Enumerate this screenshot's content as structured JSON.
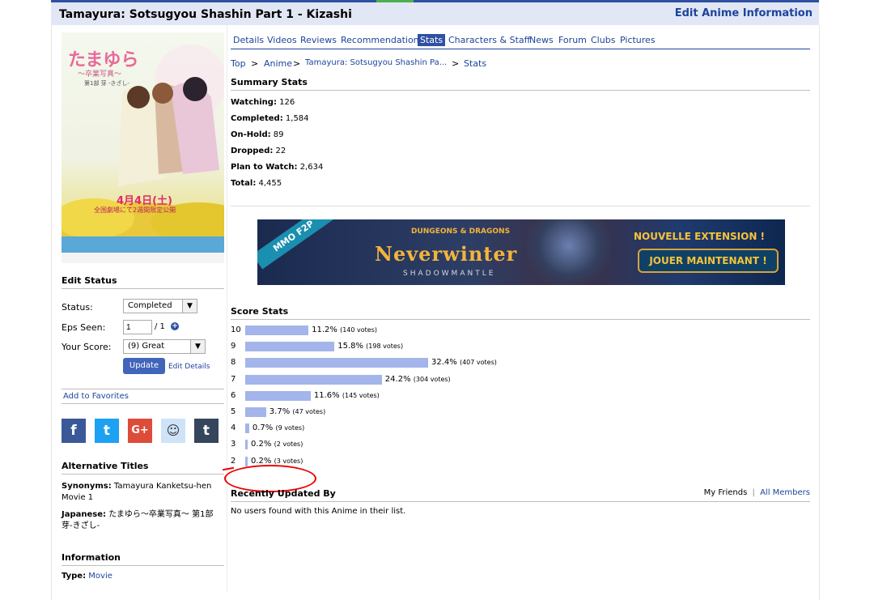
{
  "header": {
    "title": "Tamayura: Sotsugyou Shashin Part 1 - Kizashi",
    "edit_link": "Edit Anime Information"
  },
  "poster": {
    "jp_title": "たまゆら",
    "jp_sub": "〜卒業写真〜",
    "jp_part": "第1部 芽 -きざし-",
    "date": "4月4日(土)",
    "release": "全国劇場にて2週間限定公開"
  },
  "edit_status": {
    "heading": "Edit Status",
    "status_label": "Status:",
    "status_value": "Completed",
    "eps_label": "Eps Seen:",
    "eps_value": "1",
    "eps_total": "/ 1",
    "score_label": "Your Score:",
    "score_value": "(9) Great",
    "update_label": "Update",
    "edit_details_label": "Edit Details"
  },
  "favorites_label": "Add to Favorites",
  "social": [
    {
      "label": "f",
      "icon": "facebook-icon",
      "color": "#3b5998"
    },
    {
      "label": "t",
      "icon": "twitter-icon",
      "color": "#1da1f2"
    },
    {
      "label": "G+",
      "icon": "google-plus-icon",
      "color": "#dd4b39"
    },
    {
      "label": "☺",
      "icon": "reddit-icon",
      "color": "#cee3f8"
    },
    {
      "label": "t",
      "icon": "tumblr-icon",
      "color": "#35465c"
    }
  ],
  "alt_titles": {
    "heading": "Alternative Titles",
    "synonyms_label": "Synonyms:",
    "synonyms_value": "Tamayura Kanketsu-hen Movie 1",
    "japanese_label": "Japanese:",
    "japanese_value": "たまゆら〜卒業写真〜 第1部 芽-きざし-"
  },
  "information": {
    "heading": "Information",
    "type_label": "Type:",
    "type_value": "Movie"
  },
  "tabs": [
    "Details",
    "Videos",
    "Reviews",
    "Recommendations",
    "Stats",
    "Characters & Staff",
    "News",
    "Forum",
    "Clubs",
    "Pictures"
  ],
  "active_tab": "Stats",
  "breadcrumb": [
    "Top",
    "Anime",
    "Tamayura: Sotsugyou Shashin Pa...",
    "Stats"
  ],
  "summary": {
    "heading": "Summary Stats",
    "items": [
      {
        "label": "Watching:",
        "value": "126"
      },
      {
        "label": "Completed:",
        "value": "1,584"
      },
      {
        "label": "On-Hold:",
        "value": "89"
      },
      {
        "label": "Dropped:",
        "value": "22"
      },
      {
        "label": "Plan to Watch:",
        "value": "2,634"
      },
      {
        "label": "Total:",
        "value": "4,455"
      }
    ]
  },
  "ad": {
    "badge": "MMO F2P",
    "brand": "DUNGEONS & DRAGONS",
    "logo": "Neverwinter",
    "sub": "SHADOWMANTLE",
    "headline": "NOUVELLE EXTENSION !",
    "cta": "JOUER MAINTENANT !"
  },
  "score_stats": {
    "heading": "Score Stats",
    "rows": [
      {
        "score": "10",
        "pct": "11.2%",
        "votes": "(140 votes)",
        "fraction": 0.112
      },
      {
        "score": "9",
        "pct": "15.8%",
        "votes": "(198 votes)",
        "fraction": 0.158
      },
      {
        "score": "8",
        "pct": "32.4%",
        "votes": "(407 votes)",
        "fraction": 0.324
      },
      {
        "score": "7",
        "pct": "24.2%",
        "votes": "(304 votes)",
        "fraction": 0.242
      },
      {
        "score": "6",
        "pct": "11.6%",
        "votes": "(145 votes)",
        "fraction": 0.116
      },
      {
        "score": "5",
        "pct": "3.7%",
        "votes": "(47 votes)",
        "fraction": 0.037
      },
      {
        "score": "4",
        "pct": "0.7%",
        "votes": "(9 votes)",
        "fraction": 0.007
      },
      {
        "score": "3",
        "pct": "0.2%",
        "votes": "(2 votes)",
        "fraction": 0.002
      },
      {
        "score": "2",
        "pct": "0.2%",
        "votes": "(3 votes)",
        "fraction": 0.002
      }
    ]
  },
  "recent": {
    "heading": "Recently Updated By",
    "friends": "My Friends",
    "divider": "|",
    "all_members": "All Members",
    "empty": "No users found with this Anime in their list."
  }
}
